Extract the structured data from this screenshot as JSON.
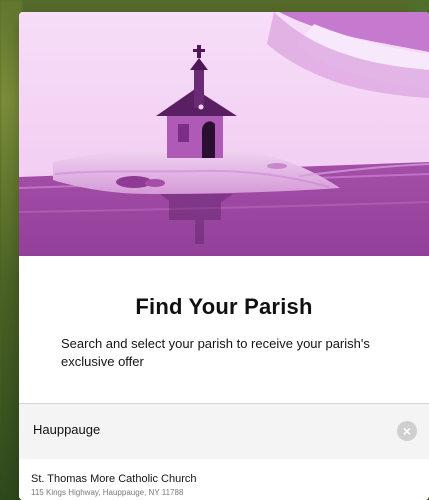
{
  "colors": {
    "hero_bg": "#efc7f0",
    "hero_dark": "#a74da8",
    "hero_mid": "#c57ad0",
    "hero_light": "#f7e8fb",
    "text_main": "#111111",
    "text_secondary": "#7a7a7a",
    "search_bg": "#f4f4f4",
    "clear_bg": "#cfcfcf"
  },
  "modal": {
    "title": "Find Your Parish",
    "subtitle": "Search and select your parish to receive your parish's exclusive offer",
    "search": {
      "value": "Hauppauge",
      "placeholder": ""
    },
    "clear_icon": "×",
    "results": [
      {
        "name": "St. Thomas More Catholic Church",
        "address": "115 Kings Highway, Hauppauge, NY 11788"
      }
    ]
  },
  "icons": {
    "clear": "clear-icon",
    "illustration": "church-illustration"
  }
}
